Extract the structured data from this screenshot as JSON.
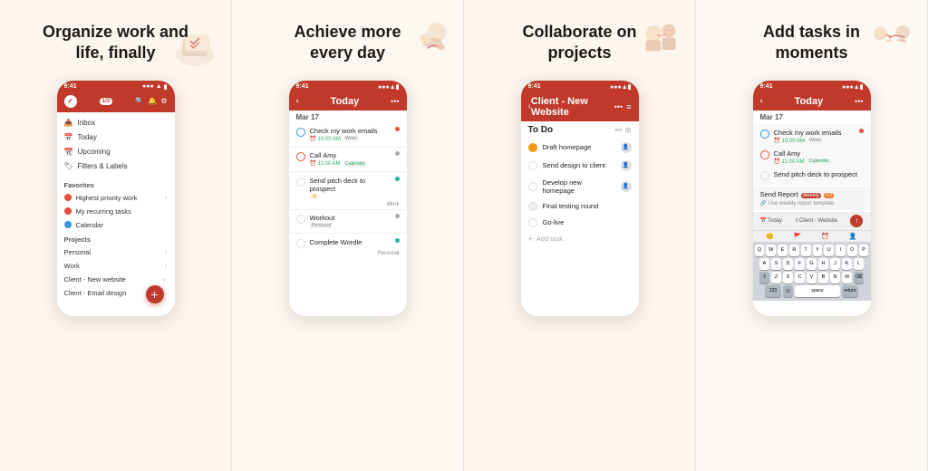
{
  "panels": [
    {
      "id": "panel-1",
      "heading": "Organize work and\nlife, finally",
      "bg": "#fdf6ee",
      "phone": {
        "status": {
          "time": "9:41",
          "signal": "●●●",
          "wifi": "▲",
          "battery": "■"
        },
        "badge": "1/3",
        "nav_items": [
          {
            "icon": "📥",
            "label": "Inbox"
          },
          {
            "icon": "📅",
            "label": "Today"
          },
          {
            "icon": "📆",
            "label": "Upcoming"
          },
          {
            "icon": "🏷",
            "label": "Filters & Labels"
          }
        ],
        "section_favorites": "Favorites",
        "favorites": [
          {
            "color": "#e74c3c",
            "label": "Highest priority work"
          },
          {
            "color": "#e74c3c",
            "label": "My recurring tasks"
          },
          {
            "color": "#3498db",
            "label": "Calendar"
          }
        ],
        "section_projects": "Projects",
        "projects": [
          {
            "label": "Personal",
            "has_arrow": true
          },
          {
            "label": "Work",
            "has_arrow": true
          },
          {
            "label": "Client - New website",
            "has_arrow": false
          },
          {
            "label": "Client - Email design",
            "has_arrow": false
          }
        ]
      }
    },
    {
      "id": "panel-2",
      "heading": "Achieve more\nevery day",
      "bg": "#fdf8f2",
      "phone": {
        "status": {
          "time": "9:41"
        },
        "toolbar_title": "Today",
        "date": "Mar 17",
        "tasks": [
          {
            "name": "Check my work emails",
            "time": "10:00 AM",
            "tag": "Work",
            "dot": "red",
            "circle": "blue"
          },
          {
            "name": "Call Amy",
            "time": "11:00 AM",
            "tag": "Calendar",
            "dot": "gray",
            "circle": "red"
          },
          {
            "name": "Send pitch deck to prospect",
            "tag": "Work",
            "dot": "teal",
            "circle": "none"
          },
          {
            "name": "Workout",
            "tag": "Personal",
            "dot": "gray",
            "circle": "none"
          },
          {
            "name": "Complete Wordle",
            "tag": "Personal",
            "dot": "teal",
            "circle": "none"
          }
        ]
      }
    },
    {
      "id": "panel-3",
      "heading": "Collaborate on\nprojects",
      "bg": "#fdf6ee",
      "phone": {
        "status": {
          "time": "9:41"
        },
        "toolbar_title": "Client - New Website",
        "section": "To Do",
        "tasks": [
          {
            "name": "Draft homepage",
            "done": true,
            "has_avatar": true
          },
          {
            "name": "Send design to client",
            "done": false,
            "has_avatar": true
          },
          {
            "name": "Develop new homepage",
            "done": false,
            "has_avatar": true
          },
          {
            "name": "Final testing round",
            "done": false,
            "has_avatar": false
          },
          {
            "name": "Go-live",
            "done": false,
            "has_avatar": false
          }
        ],
        "add_task": "Add task"
      }
    },
    {
      "id": "panel-4",
      "heading": "Add tasks in\nmoments",
      "bg": "#fdf8f3",
      "phone": {
        "status": {
          "time": "9:41"
        },
        "toolbar_title": "Today",
        "date": "Mar 17",
        "tasks": [
          {
            "name": "Check my work emails",
            "time": "10:00 AM",
            "tag": "Work",
            "circle": "blue"
          },
          {
            "name": "Call Amy",
            "time": "11:00 AM",
            "tag": "Calendar",
            "circle": "red"
          },
          {
            "name": "Send pitch deck to prospect",
            "circle": "none"
          }
        ],
        "input_text": "Send Report",
        "input_tag": "weekly",
        "input_priority": "P2",
        "input_sub": "Use weekly report template",
        "toolbar_today": "Today",
        "toolbar_website": "Client - Website",
        "keyboard_rows": [
          [
            "Q",
            "W",
            "E",
            "R",
            "T",
            "Y",
            "U",
            "I",
            "O",
            "P"
          ],
          [
            "A",
            "S",
            "D",
            "F",
            "G",
            "H",
            "J",
            "K",
            "L"
          ],
          [
            "⇧",
            "Z",
            "X",
            "C",
            "V",
            "B",
            "N",
            "M",
            "⌫"
          ],
          [
            "123",
            " ",
            "space",
            "return"
          ]
        ]
      }
    }
  ]
}
